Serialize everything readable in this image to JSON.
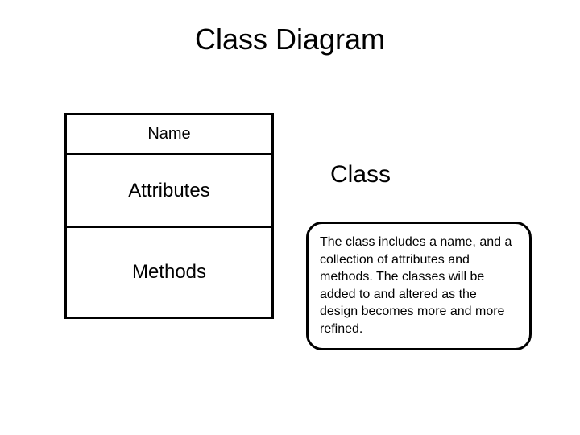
{
  "title": "Class Diagram",
  "classBox": {
    "name": "Name",
    "attributes": "Attributes",
    "methods": "Methods"
  },
  "classLabel": "Class",
  "description": "The class includes a name, and a collection of attributes and methods. The classes will be added to and altered as the design becomes more and more refined."
}
